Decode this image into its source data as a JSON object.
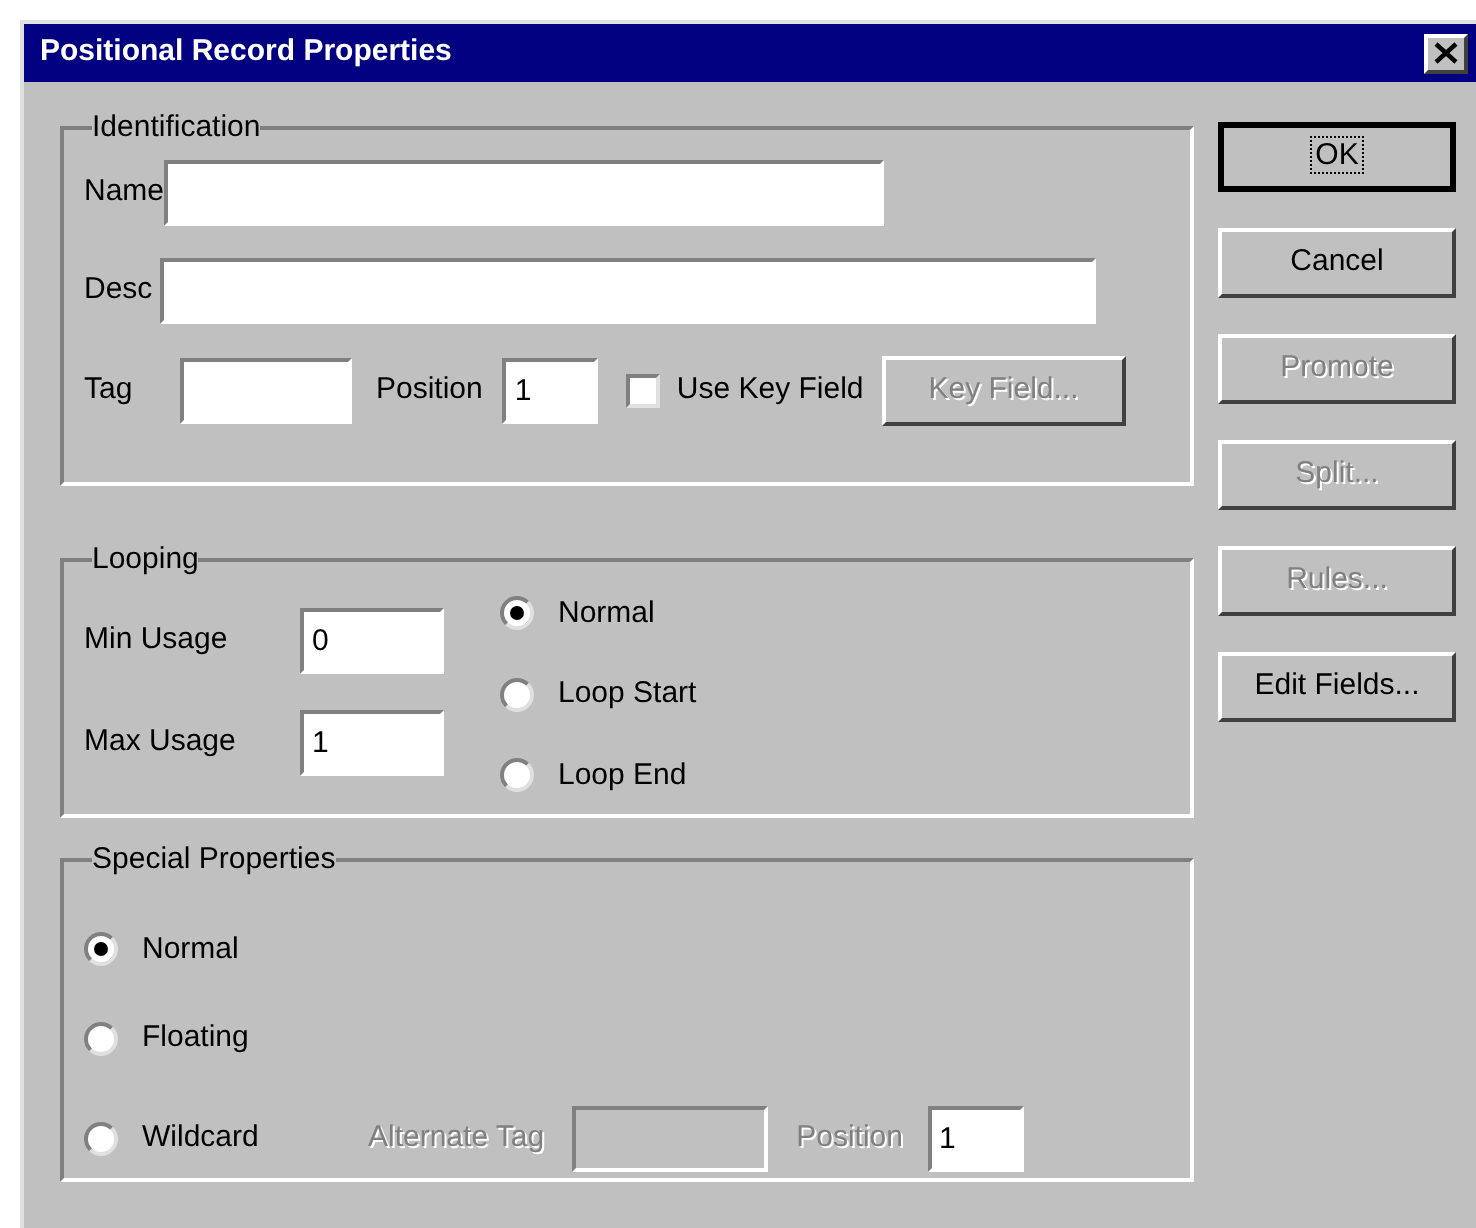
{
  "window": {
    "title": "Positional Record Properties"
  },
  "identification": {
    "title": "Identification",
    "name": {
      "label": "Name"
    },
    "desc": {
      "label": "Desc"
    },
    "tag": {
      "label": "Tag"
    },
    "position": {
      "label": "Position",
      "value": "1"
    },
    "use_key_field": {
      "label": "Use Key Field",
      "checked": false
    },
    "key_field_button": {
      "label": "Key Field...",
      "disabled": true
    }
  },
  "looping": {
    "title": "Looping",
    "min_usage": {
      "label": "Min Usage",
      "value": "0"
    },
    "max_usage": {
      "label": "Max Usage",
      "value": "1"
    },
    "options": [
      {
        "label": "Normal",
        "selected": true
      },
      {
        "label": "Loop Start",
        "selected": false
      },
      {
        "label": "Loop End",
        "selected": false
      }
    ]
  },
  "special_properties": {
    "title": "Special Properties",
    "options": [
      {
        "label": "Normal",
        "selected": true
      },
      {
        "label": "Floating",
        "selected": false
      },
      {
        "label": "Wildcard",
        "selected": false
      }
    ],
    "alternate_tag": {
      "label": "Alternate Tag",
      "disabled": true
    },
    "position": {
      "label": "Position",
      "value": "1",
      "disabled": true
    }
  },
  "buttons": [
    {
      "label": "OK",
      "disabled": false,
      "default": true
    },
    {
      "label": "Cancel",
      "disabled": false,
      "default": false
    },
    {
      "label": "Promote",
      "disabled": true,
      "default": false
    },
    {
      "label": "Split...",
      "disabled": true,
      "default": false
    },
    {
      "label": "Rules...",
      "disabled": true,
      "default": false
    },
    {
      "label": "Edit Fields...",
      "disabled": false,
      "default": false
    }
  ]
}
